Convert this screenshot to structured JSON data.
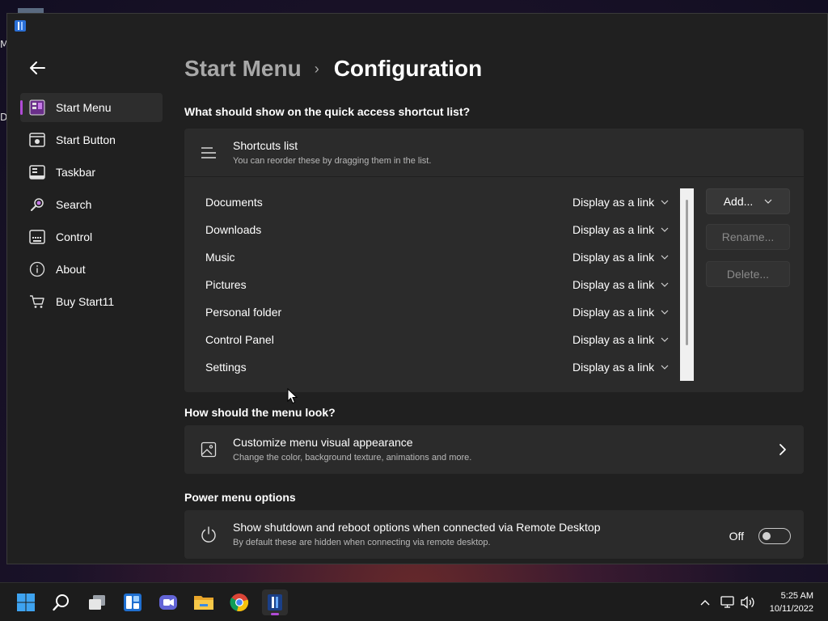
{
  "desktop": {
    "edge_letters": [
      "M",
      "D"
    ]
  },
  "window": {
    "app_icon": "start11-logo-icon"
  },
  "sidebar": {
    "back_icon": "back-arrow-icon",
    "items": [
      {
        "label": "Start Menu",
        "icon": "start-menu-icon",
        "active": true
      },
      {
        "label": "Start Button",
        "icon": "start-button-icon",
        "active": false
      },
      {
        "label": "Taskbar",
        "icon": "taskbar-icon",
        "active": false
      },
      {
        "label": "Search",
        "icon": "search-icon",
        "active": false
      },
      {
        "label": "Control",
        "icon": "control-icon",
        "active": false
      },
      {
        "label": "About",
        "icon": "info-icon",
        "active": false
      },
      {
        "label": "Buy Start11",
        "icon": "cart-icon",
        "active": false
      }
    ]
  },
  "header": {
    "parent": "Start Menu",
    "separator": "›",
    "current": "Configuration"
  },
  "quick_access": {
    "heading": "What should show on the quick access shortcut list?",
    "card_title": "Shortcuts list",
    "card_desc": "You can reorder these by dragging them in the list.",
    "rows": [
      {
        "name": "Documents",
        "mode": "Display as a link"
      },
      {
        "name": "Downloads",
        "mode": "Display as a link"
      },
      {
        "name": "Music",
        "mode": "Display as a link"
      },
      {
        "name": "Pictures",
        "mode": "Display as a link"
      },
      {
        "name": "Personal folder",
        "mode": "Display as a link"
      },
      {
        "name": "Control Panel",
        "mode": "Display as a link"
      },
      {
        "name": "Settings",
        "mode": "Display as a link"
      }
    ],
    "buttons": {
      "add": "Add...",
      "rename": "Rename...",
      "delete": "Delete..."
    }
  },
  "look": {
    "heading": "How should the menu look?",
    "title": "Customize menu visual appearance",
    "desc": "Change the color, background texture, animations and more."
  },
  "power": {
    "heading": "Power menu options",
    "title": "Show shutdown and reboot options when connected via Remote Desktop",
    "desc": "By default these are hidden when connecting via remote desktop.",
    "toggle_label": "Off",
    "toggle_on": false
  },
  "taskbar": {
    "icons": [
      "windows-start-icon",
      "search-icon",
      "task-view-icon",
      "widgets-icon",
      "teams-chat-icon",
      "file-explorer-icon",
      "chrome-icon",
      "start11-app-icon"
    ],
    "tray": [
      "chevron-up-icon",
      "network-icon",
      "volume-icon"
    ],
    "time": "5:25 AM",
    "date": "10/11/2022"
  },
  "colors": {
    "accent": "#b04bd6",
    "window_bg": "#202020",
    "card_bg": "#2b2b2b"
  }
}
